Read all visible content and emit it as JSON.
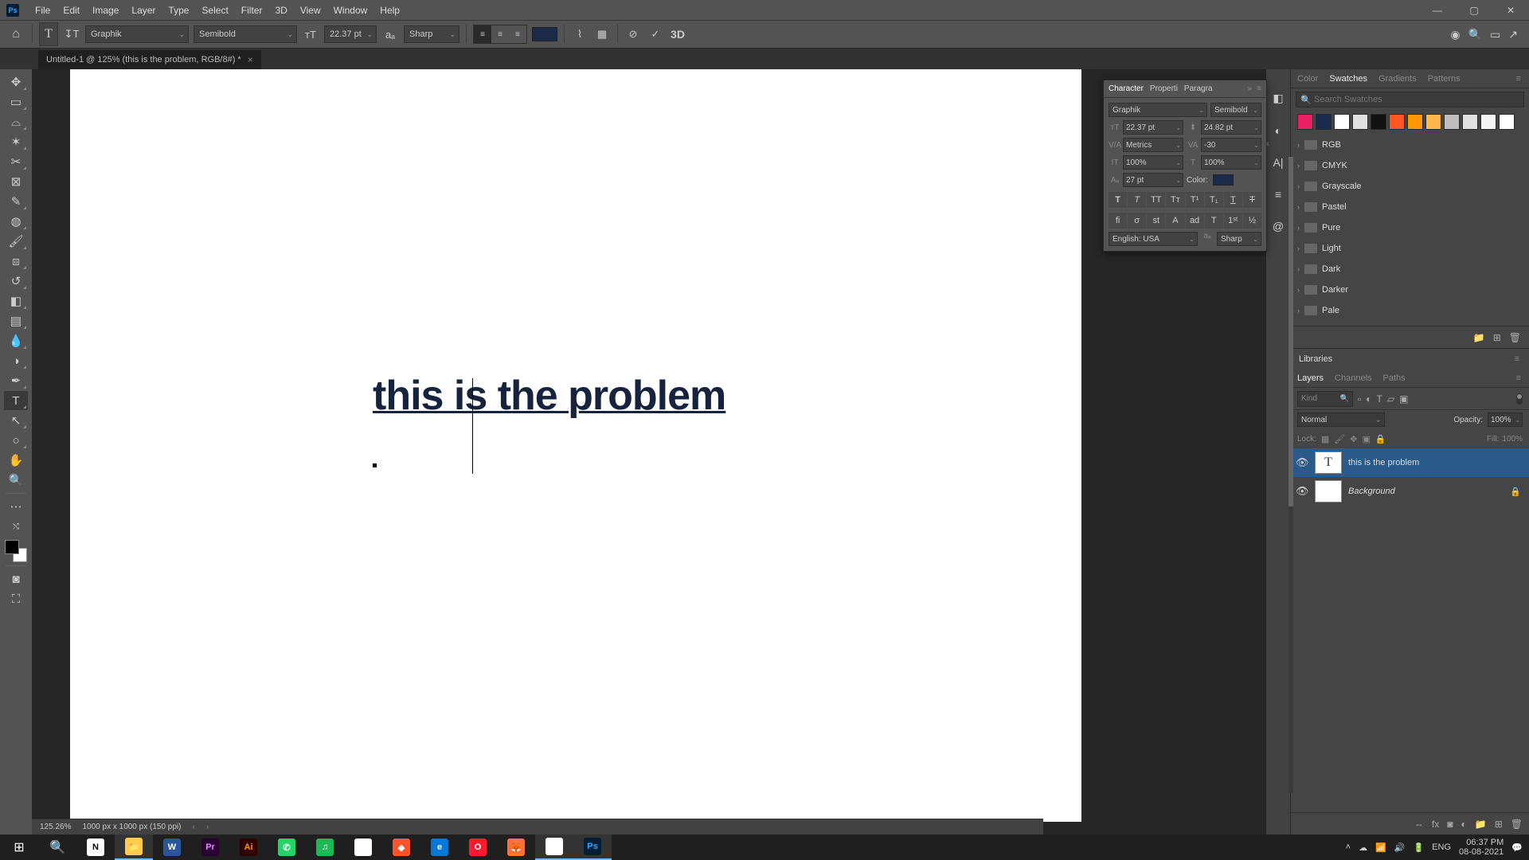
{
  "menu": {
    "items": [
      "File",
      "Edit",
      "Image",
      "Layer",
      "Type",
      "Select",
      "Filter",
      "3D",
      "View",
      "Window",
      "Help"
    ]
  },
  "optionsBar": {
    "fontFamily": "Graphik",
    "fontStyle": "Semibold",
    "fontSize": "22.37 pt",
    "antiAlias": "Sharp",
    "threeD": "3D"
  },
  "documentTab": "Untitled-1 @ 125% (this is the problem, RGB/8#) *",
  "canvasText": "this is the problem",
  "characterPanel": {
    "tabs": [
      "Character",
      "Properti",
      "Paragra"
    ],
    "fontFamily": "Graphik",
    "fontStyle": "Semibold",
    "size": "22.37 pt",
    "leading": "24.82 pt",
    "kerning": "Metrics",
    "tracking": "-30",
    "vscale": "100%",
    "hscale": "100%",
    "baseline": "27 pt",
    "colorLabel": "Color:",
    "lang": "English: USA",
    "aa": "Sharp"
  },
  "swatches": {
    "tabs": [
      "Color",
      "Swatches",
      "Gradients",
      "Patterns"
    ],
    "searchPlaceholder": "Search Swatches",
    "chipColors": [
      "#e91e63",
      "#1a2a4a",
      "#ffffff",
      "#e0e0e0",
      "#111111",
      "#ff5722",
      "#ff9800",
      "#ffb74d",
      "#bdbdbd",
      "#e0e0e0",
      "#f5f5f5",
      "#ffffff"
    ],
    "folders": [
      "RGB",
      "CMYK",
      "Grayscale",
      "Pastel",
      "Pure",
      "Light",
      "Dark",
      "Darker",
      "Pale"
    ]
  },
  "libraries": {
    "label": "Libraries"
  },
  "layers": {
    "tabs": [
      "Layers",
      "Channels",
      "Paths"
    ],
    "kind": "Kind",
    "blend": "Normal",
    "opacityLabel": "Opacity:",
    "opacity": "100%",
    "lockLabel": "Lock:",
    "fillLabel": "Fill:",
    "fill": "100%",
    "items": [
      {
        "name": "this is the problem",
        "type": "text",
        "selected": true
      },
      {
        "name": "Background",
        "type": "bg",
        "locked": true
      }
    ]
  },
  "status": {
    "zoom": "125.26%",
    "dims": "1000 px x 1000 px (150 ppi)"
  },
  "taskbar": {
    "time": "06:37 PM",
    "date": "08-08-2021",
    "lang": "ENG"
  }
}
